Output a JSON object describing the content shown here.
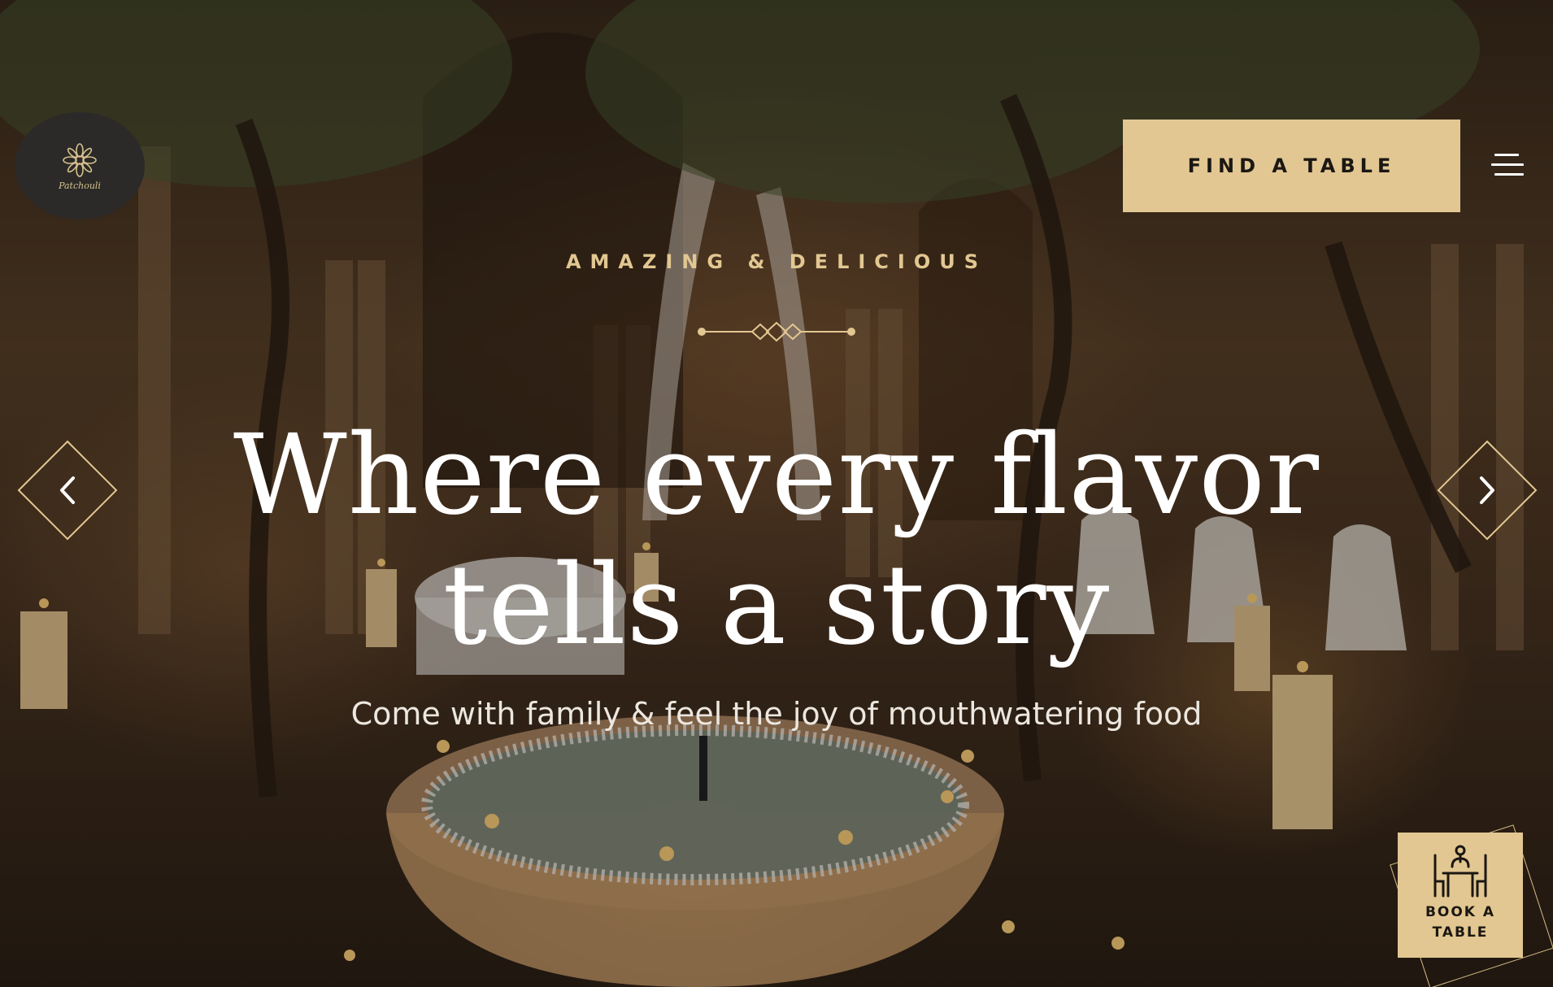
{
  "brand": {
    "logo_text": "Patchouli",
    "logo_icon": "floral-mandala-icon"
  },
  "header": {
    "find_table_label": "FIND A TABLE",
    "menu_icon": "hamburger-menu-icon"
  },
  "hero": {
    "eyebrow": "AMAZING & DELICIOUS",
    "headline_line1": "Where every flavor",
    "headline_line2": "tells a story",
    "subheadline": "Come with family & feel the joy of mouthwatering food"
  },
  "slider": {
    "prev_icon": "chevron-left-icon",
    "next_icon": "chevron-right-icon"
  },
  "booking": {
    "label_line1": "BOOK A",
    "label_line2": "TABLE",
    "icon": "dining-table-icon"
  },
  "colors": {
    "accent": "#e2c792",
    "text_dark": "#1b1712",
    "logo_bg": "#2b2a28"
  }
}
